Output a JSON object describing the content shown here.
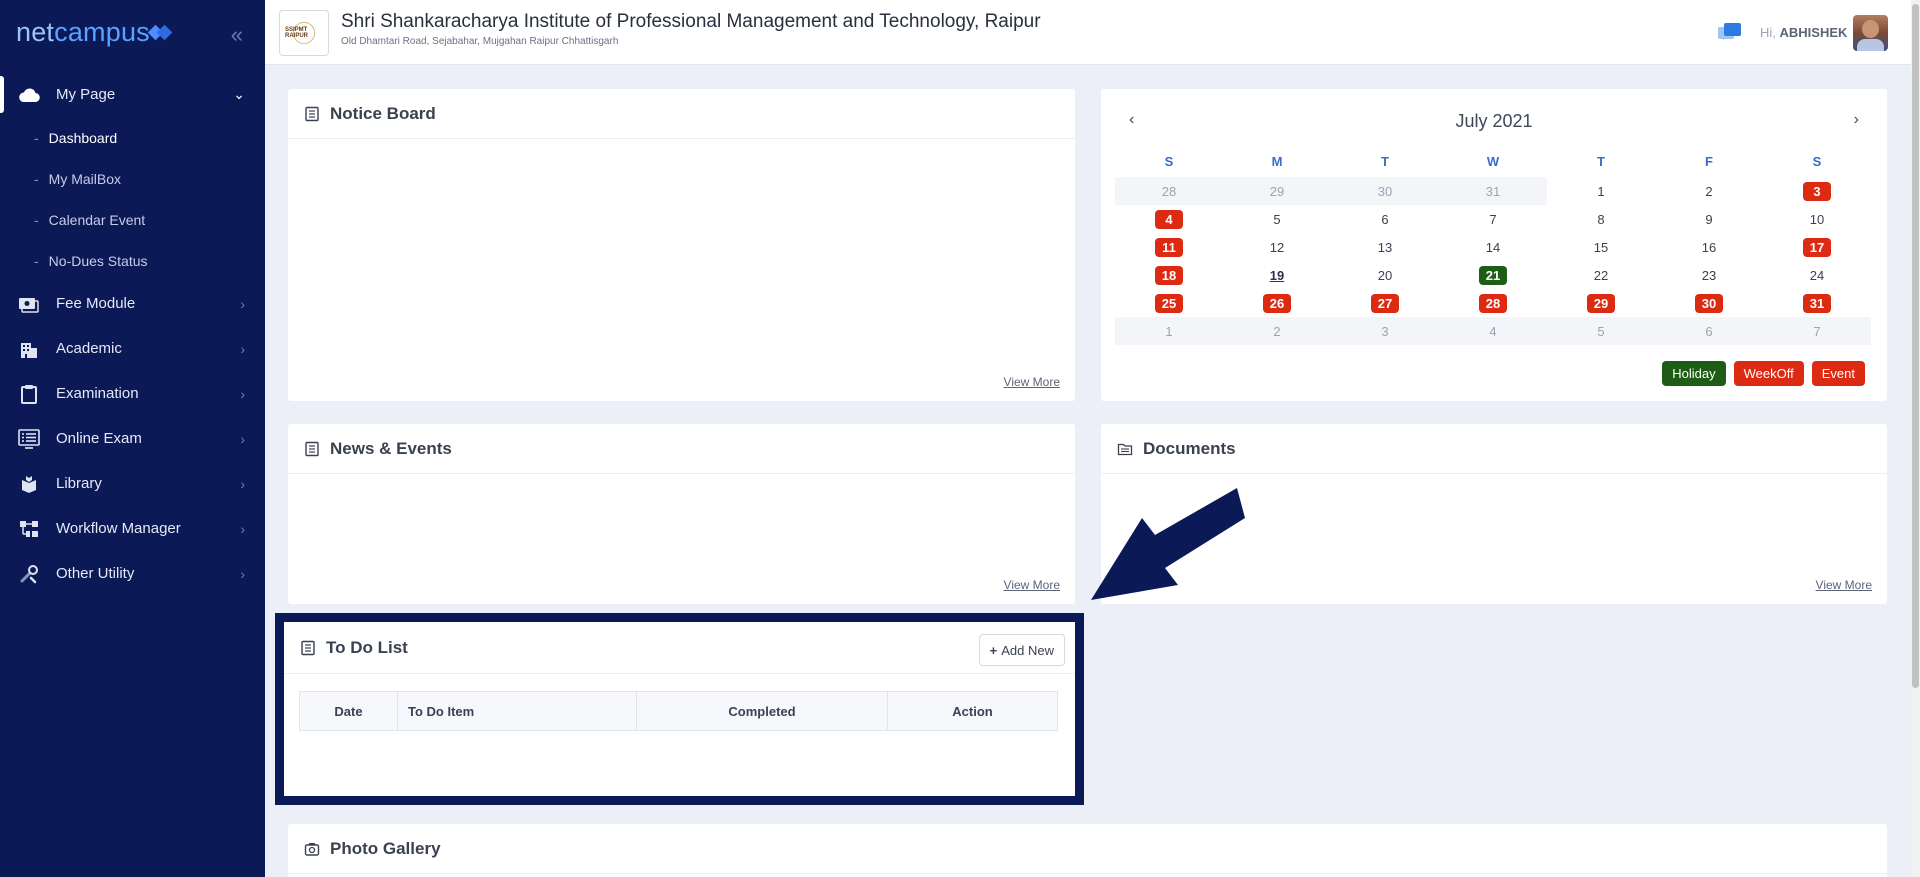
{
  "brand": {
    "name_part1": "net",
    "name_part2": "campus"
  },
  "sidebar": {
    "my_page": "My Page",
    "sub_items": [
      "Dashboard",
      "My MailBox",
      "Calendar Event",
      "No-Dues Status"
    ],
    "items": [
      {
        "label": "Fee Module",
        "icon": "fee-icon"
      },
      {
        "label": "Academic",
        "icon": "building-icon"
      },
      {
        "label": "Examination",
        "icon": "clipboard-icon"
      },
      {
        "label": "Online Exam",
        "icon": "monitor-list-icon"
      },
      {
        "label": "Library",
        "icon": "book-hand-icon"
      },
      {
        "label": "Workflow Manager",
        "icon": "workflow-icon"
      },
      {
        "label": "Other Utility",
        "icon": "tools-icon"
      }
    ]
  },
  "header": {
    "institute_name": "Shri Shankaracharya Institute of Professional Management and Technology, Raipur",
    "institute_address": "Old Dhamtari Road, Sejabahar, Mujgahan Raipur Chhattisgarh",
    "logo_text": "SSIPMT RAIPUR",
    "greeting_prefix": "Hi,",
    "user_name": "ABHISHEK"
  },
  "notice_board": {
    "title": "Notice Board",
    "view_more": "View More"
  },
  "news_events": {
    "title": "News & Events",
    "view_more": "View More"
  },
  "documents": {
    "title": "Documents",
    "view_more": "View More"
  },
  "todo": {
    "title": "To Do List",
    "add_new": "Add New",
    "columns": [
      "Date",
      "To Do Item",
      "Completed",
      "Action"
    ]
  },
  "photo_gallery": {
    "title": "Photo Gallery"
  },
  "calendar": {
    "month_label": "July 2021",
    "prev": "‹",
    "next": "›",
    "weekdays": [
      "S",
      "M",
      "T",
      "W",
      "T",
      "F",
      "S"
    ],
    "weeks": [
      [
        {
          "d": "28",
          "muted": true
        },
        {
          "d": "29",
          "muted": true
        },
        {
          "d": "30",
          "muted": true
        },
        {
          "d": "31",
          "muted": true
        },
        {
          "d": "1"
        },
        {
          "d": "2"
        },
        {
          "d": "3",
          "mark": "red"
        }
      ],
      [
        {
          "d": "4",
          "mark": "red"
        },
        {
          "d": "5"
        },
        {
          "d": "6"
        },
        {
          "d": "7"
        },
        {
          "d": "8"
        },
        {
          "d": "9"
        },
        {
          "d": "10"
        }
      ],
      [
        {
          "d": "11",
          "mark": "red"
        },
        {
          "d": "12"
        },
        {
          "d": "13"
        },
        {
          "d": "14"
        },
        {
          "d": "15"
        },
        {
          "d": "16"
        },
        {
          "d": "17",
          "mark": "red"
        }
      ],
      [
        {
          "d": "18",
          "mark": "red"
        },
        {
          "d": "19",
          "today": true
        },
        {
          "d": "20"
        },
        {
          "d": "21",
          "mark": "green"
        },
        {
          "d": "22"
        },
        {
          "d": "23"
        },
        {
          "d": "24"
        }
      ],
      [
        {
          "d": "25",
          "mark": "red"
        },
        {
          "d": "26",
          "mark": "red"
        },
        {
          "d": "27",
          "mark": "red"
        },
        {
          "d": "28",
          "mark": "red"
        },
        {
          "d": "29",
          "mark": "red"
        },
        {
          "d": "30",
          "mark": "red"
        },
        {
          "d": "31",
          "mark": "red"
        }
      ],
      [
        {
          "d": "1",
          "muted": true
        },
        {
          "d": "2",
          "muted": true
        },
        {
          "d": "3",
          "muted": true
        },
        {
          "d": "4",
          "muted": true
        },
        {
          "d": "5",
          "muted": true
        },
        {
          "d": "6",
          "muted": true
        },
        {
          "d": "7",
          "muted": true
        }
      ]
    ],
    "legend": [
      {
        "label": "Holiday",
        "color": "#1e5d16"
      },
      {
        "label": "WeekOff",
        "color": "#dd2a12"
      },
      {
        "label": "Event",
        "color": "#dd2a12"
      }
    ]
  },
  "colors": {
    "sidebar_bg": "#0b1957",
    "accent_blue": "#3b6cc7",
    "weekoff_red": "#dd2a12",
    "holiday_green": "#1e5d16"
  }
}
